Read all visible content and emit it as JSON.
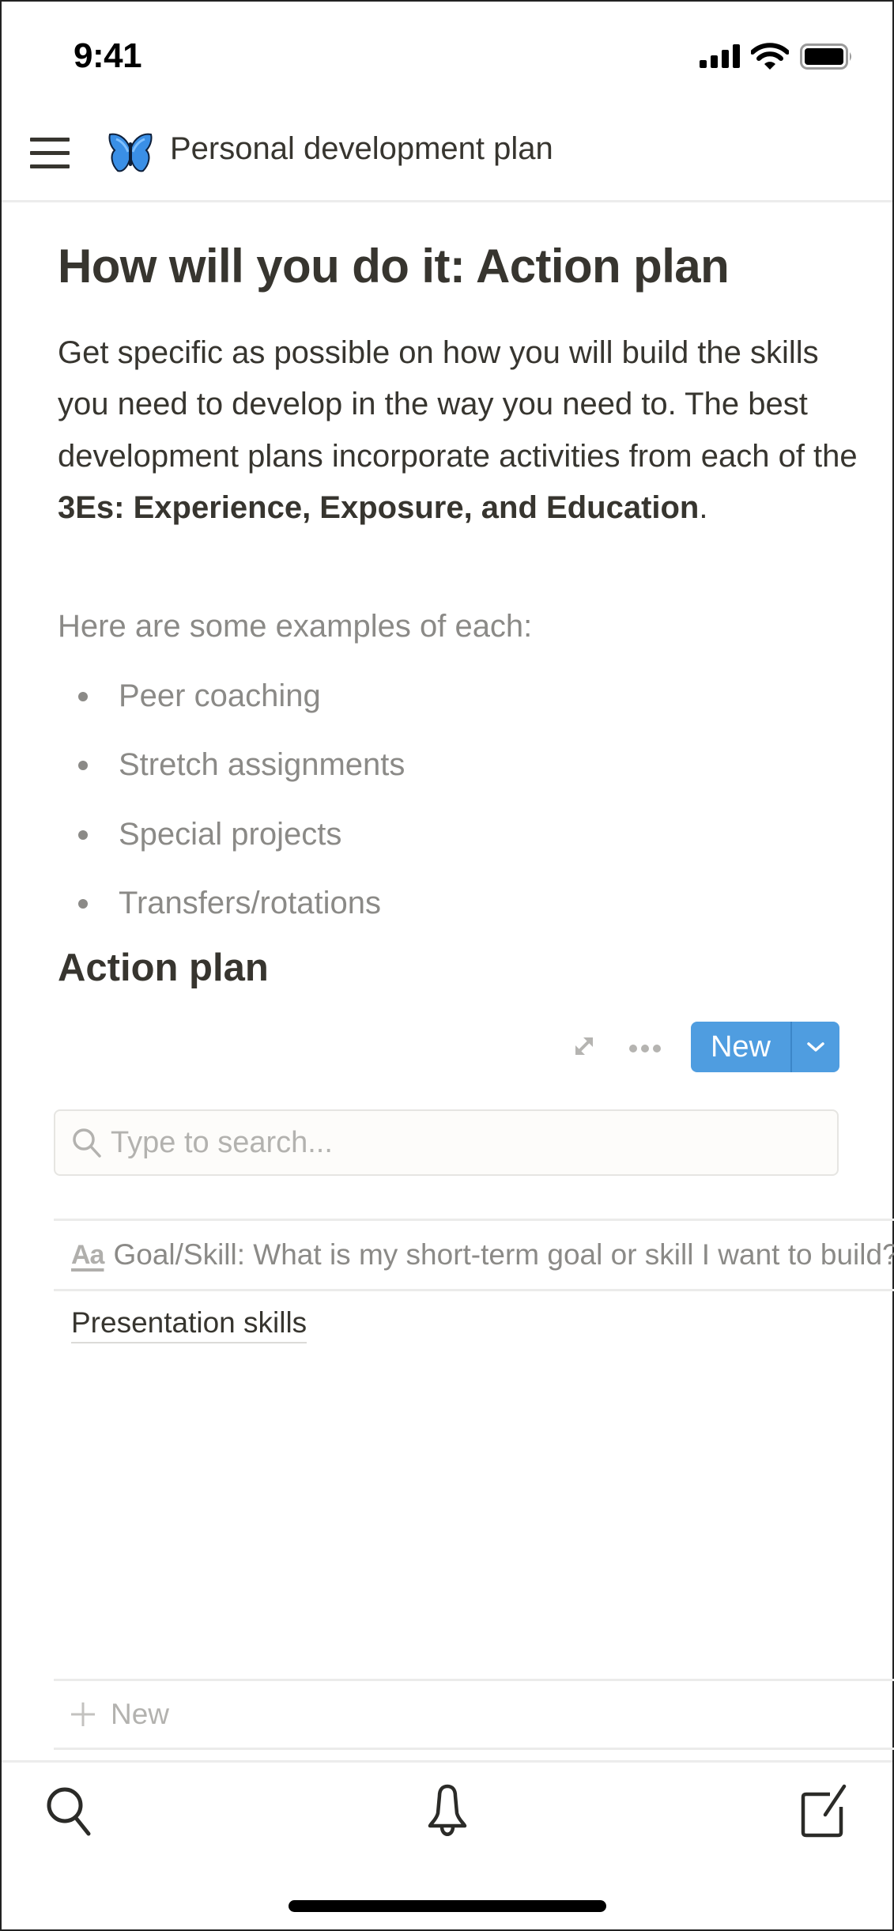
{
  "status_bar": {
    "time": "9:41",
    "icons": [
      "signal-icon",
      "wifi-icon",
      "battery-icon"
    ]
  },
  "header": {
    "menu_icon": "hamburger-menu-icon",
    "page_icon": "butterfly-emoji",
    "title": "Personal development plan"
  },
  "content": {
    "heading": "How will you do it: Action plan",
    "paragraph": {
      "text_before": "Get specific as possible on how you will build the skills you need to develop in the way you need to. The best development plans incorporate activities from each of the ",
      "bold": "3Es: Experience, Exposure, and Education",
      "text_after": "."
    },
    "examples_intro": "Here are some examples of each:",
    "examples": [
      "Peer coaching",
      "Stretch assignments",
      "Special projects",
      "Transfers/rotations"
    ],
    "section_heading": "Action plan"
  },
  "database": {
    "toolbar": {
      "expand_icon": "expand-arrows-icon",
      "more_icon": "more-dots-icon",
      "new_label": "New",
      "new_dropdown_icon": "chevron-down-icon"
    },
    "search": {
      "placeholder": "Type to search...",
      "value": ""
    },
    "columns": [
      {
        "type_icon": "Aa",
        "title": "Goal/Skill: What is my short-term goal or skill I want to build?"
      }
    ],
    "rows": [
      {
        "title": "Presentation skills"
      }
    ],
    "add_row_label": "New"
  },
  "tab_bar": {
    "items": [
      "search-icon",
      "bell-icon",
      "compose-icon"
    ]
  },
  "colors": {
    "accent": "#4f9de0",
    "text": "#37352f",
    "muted": "#8b8a87"
  }
}
